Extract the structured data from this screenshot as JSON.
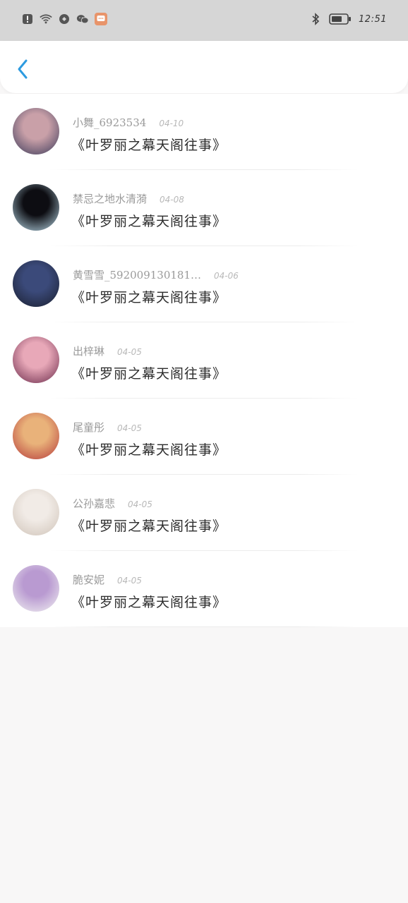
{
  "status_bar": {
    "time": "12:51",
    "icons_left": [
      "alert-icon",
      "wifi-icon",
      "shield-icon",
      "wechat-icon",
      "message-app-icon"
    ],
    "icons_right": [
      "bluetooth-icon",
      "battery-icon"
    ]
  },
  "header": {
    "back_icon": "chevron-left-icon"
  },
  "messages": [
    {
      "name": "小舞_6923534",
      "date": "04-10",
      "text": "《叶罗丽之幕天阁往事》",
      "avatar_colors": [
        "#c9a0a8",
        "#3b3a5a"
      ]
    },
    {
      "name": "禁忌之地水清漪",
      "date": "04-08",
      "text": "《叶罗丽之幕天阁往事》",
      "avatar_colors": [
        "#0d0d12",
        "#b9d9e8"
      ]
    },
    {
      "name": "黄雪雪_592009130181…",
      "date": "04-06",
      "text": "《叶罗丽之幕天阁往事》",
      "avatar_colors": [
        "#3b4a7a",
        "#1a1f2e"
      ]
    },
    {
      "name": "出梓琳",
      "date": "04-05",
      "text": "《叶罗丽之幕天阁往事》",
      "avatar_colors": [
        "#e8a8b8",
        "#6a2a4a"
      ]
    },
    {
      "name": "尾童彤",
      "date": "04-05",
      "text": "《叶罗丽之幕天阁往事》",
      "avatar_colors": [
        "#e9b27a",
        "#b53a3a"
      ]
    },
    {
      "name": "公孙嘉悲",
      "date": "04-05",
      "text": "《叶罗丽之幕天阁往事》",
      "avatar_colors": [
        "#f1ebe6",
        "#cfc3b8"
      ]
    },
    {
      "name": "脆安妮",
      "date": "04-05",
      "text": "《叶罗丽之幕天阁往事》",
      "avatar_colors": [
        "#b99ad1",
        "#f2f2f2"
      ]
    }
  ]
}
